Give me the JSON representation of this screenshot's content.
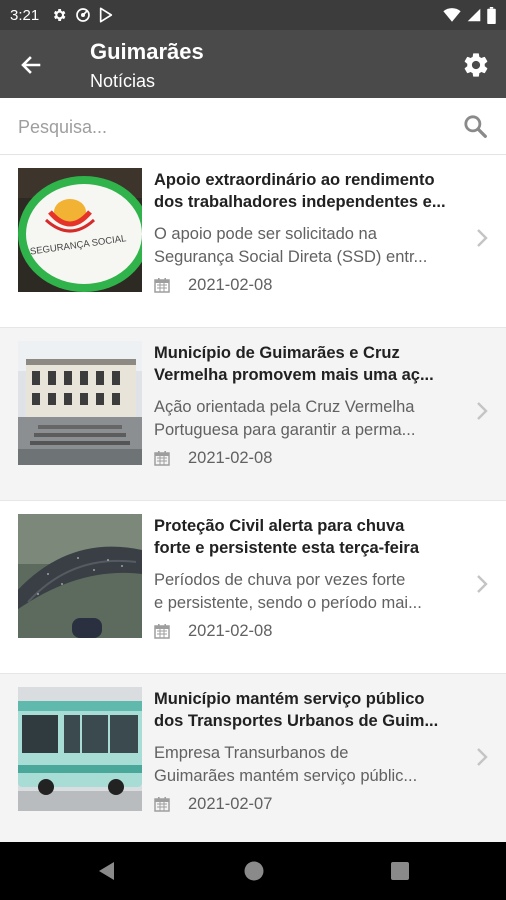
{
  "status_bar": {
    "time": "3:21",
    "left_icons": [
      "settings-gear-icon",
      "vpn-key-icon",
      "play-store-icon"
    ],
    "right_icons": [
      "wifi-icon",
      "cell-signal-icon",
      "battery-icon"
    ]
  },
  "app_bar": {
    "title": "Guimarães",
    "subtitle": "Notícias",
    "back_icon": "arrow-left-icon",
    "settings_icon": "gear-icon"
  },
  "search": {
    "placeholder": "Pesquisa...",
    "value": "",
    "icon": "search-icon"
  },
  "news": [
    {
      "title_line1": "Apoio extraordinário ao rendimento",
      "title_line2": "dos trabalhadores independentes e...",
      "desc_line1": "O apoio pode ser solicitado na",
      "desc_line2": "Segurança Social Direta (SSD) entr...",
      "date": "2021-02-08",
      "thumb_text": "SEGURANÇA SOCIAL"
    },
    {
      "title_line1": "Município de Guimarães e Cruz",
      "title_line2": "Vermelha promovem mais uma aç...",
      "desc_line1": "Ação orientada pela Cruz Vermelha",
      "desc_line2": "Portuguesa para garantir a perma...",
      "date": "2021-02-08"
    },
    {
      "title_line1": "Proteção Civil alerta para chuva",
      "title_line2": "forte e persistente esta terça-feira",
      "desc_line1": "Períodos de chuva por vezes forte",
      "desc_line2": "e persistente, sendo o período mai...",
      "date": "2021-02-08"
    },
    {
      "title_line1": "Município mantém serviço público",
      "title_line2": "dos Transportes Urbanos de Guim...",
      "desc_line1": "Empresa Transurbanos de",
      "desc_line2": "Guimarães mantém serviço públic...",
      "date": "2021-02-07"
    }
  ],
  "colors": {
    "status_bar": "#3c3c3c",
    "app_bar": "#4a4a4a",
    "alt_row": "#f4f4f4",
    "green_accent": "#2fb34a",
    "nav_bar": "#000000"
  },
  "nav_bar": {
    "icons": [
      "nav-back-icon",
      "nav-home-icon",
      "nav-recent-icon"
    ]
  }
}
